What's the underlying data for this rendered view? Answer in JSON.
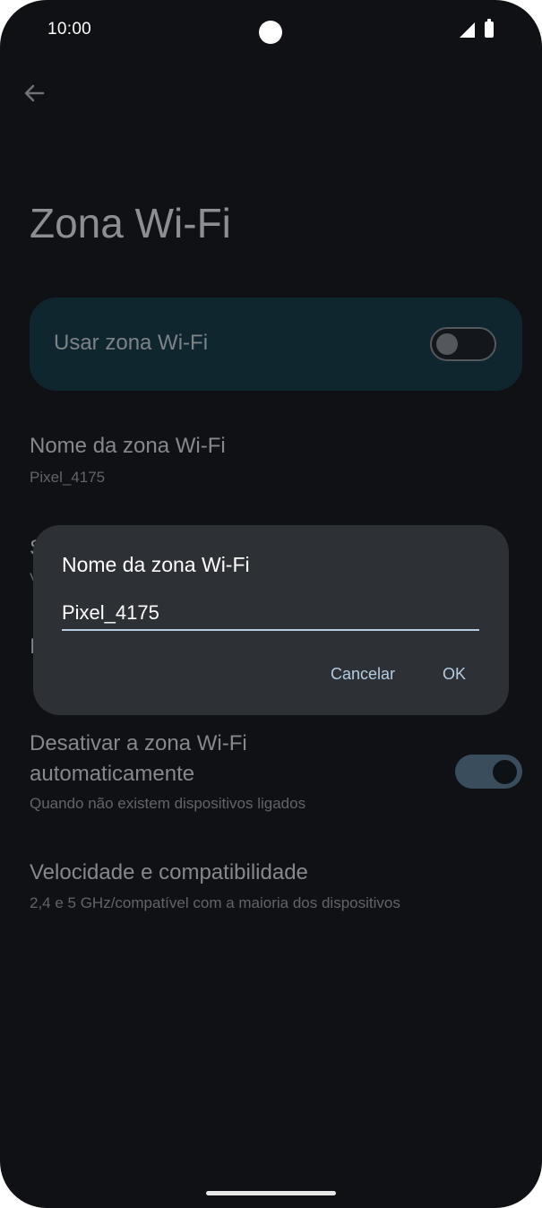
{
  "status_bar": {
    "time": "10:00"
  },
  "page": {
    "title": "Zona Wi-Fi",
    "main_toggle": {
      "label": "Usar zona Wi-Fi",
      "state": "off"
    },
    "settings": [
      {
        "title": "Nome da zona Wi-Fi",
        "summary": "Pixel_4175"
      },
      {
        "title": "Desativar a zona Wi-Fi automaticamente",
        "summary": "Quando não existem dispositivos ligados",
        "toggle": "on"
      },
      {
        "title": "Velocidade e compatibilidade",
        "summary": "2,4 e 5 GHz/compatível com a maioria dos dispositivos"
      }
    ],
    "peek_letters": {
      "first": "S",
      "first_sub": "V",
      "second": "I"
    }
  },
  "dialog": {
    "title": "Nome da zona Wi-Fi",
    "input_value": "Pixel_4175",
    "cancel_label": "Cancelar",
    "ok_label": "OK"
  },
  "icons": {
    "back": "arrow-back-icon",
    "signal": "cell-signal-icon",
    "battery": "battery-icon"
  },
  "colors": {
    "background": "#101114",
    "dialog": "#2d3034",
    "accent": "#b5cce0",
    "card": "#10262f"
  }
}
